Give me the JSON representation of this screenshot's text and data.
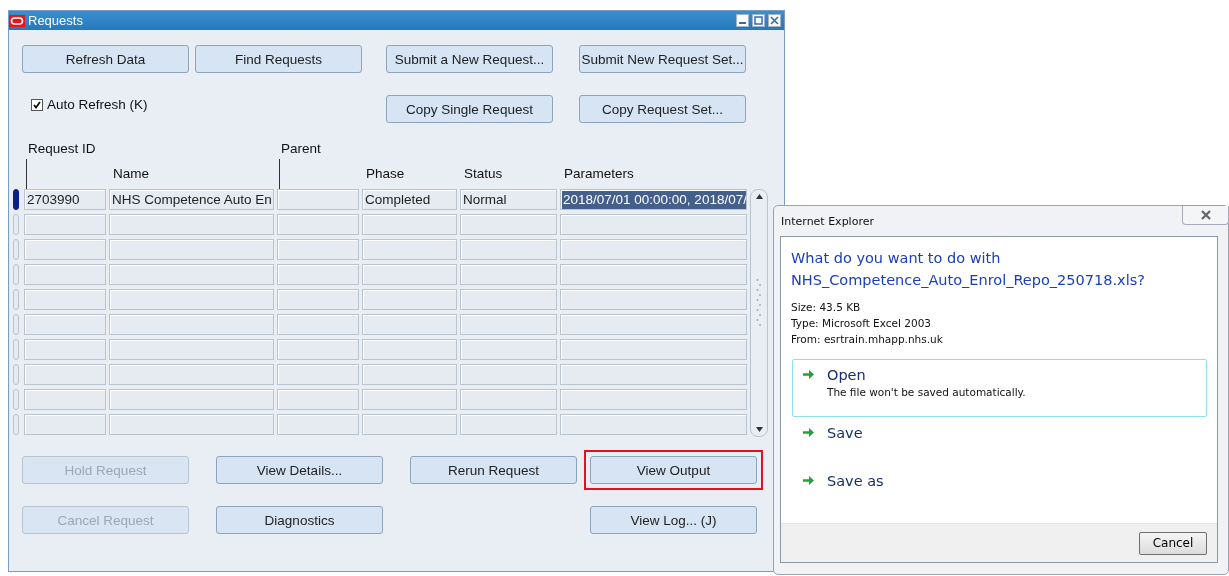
{
  "window": {
    "title": "Requests"
  },
  "button_rows": [
    [
      {
        "label": "Refresh Data",
        "disabled": false,
        "highlighted": false
      },
      {
        "label": "Find Requests",
        "disabled": false,
        "highlighted": false
      },
      {
        "label": "Submit a New Request...",
        "disabled": false,
        "highlighted": false
      },
      {
        "label": "Submit New Request Set...",
        "disabled": false,
        "highlighted": false
      }
    ],
    [
      {
        "label": "Copy Single Request",
        "disabled": false,
        "highlighted": false
      },
      {
        "label": "Copy Request Set...",
        "disabled": false,
        "highlighted": false
      }
    ]
  ],
  "auto_refresh": {
    "label": "Auto Refresh (K)",
    "checked": true
  },
  "table": {
    "columns": [
      {
        "label": "Request ID",
        "kind": "raised"
      },
      {
        "label": "Name",
        "kind": "plain"
      },
      {
        "label": "Parent",
        "kind": "raised"
      },
      {
        "label": "Phase",
        "kind": "plain"
      },
      {
        "label": "Status",
        "kind": "plain"
      },
      {
        "label": "Parameters",
        "kind": "plain"
      }
    ],
    "rows": [
      {
        "selected": true,
        "cells": [
          {
            "text": "2703990",
            "selected": false
          },
          {
            "text": "NHS Competence Auto En",
            "selected": false
          },
          {
            "text": "",
            "selected": false
          },
          {
            "text": "Completed",
            "selected": false
          },
          {
            "text": "Normal",
            "selected": false
          },
          {
            "text": "2018/07/01 00:00:00, 2018/07/",
            "selected": true
          }
        ]
      }
    ]
  },
  "action_rows": [
    [
      {
        "label": "Hold Request",
        "disabled": true,
        "highlighted": false
      },
      {
        "label": "View Details...",
        "disabled": false,
        "highlighted": false
      },
      {
        "label": "Rerun Request",
        "disabled": false,
        "highlighted": false
      },
      {
        "label": "View Output",
        "disabled": false,
        "highlighted": true
      }
    ],
    [
      {
        "label": "Cancel Request",
        "disabled": true,
        "highlighted": false
      },
      {
        "label": "Diagnostics",
        "disabled": false,
        "highlighted": false
      },
      {
        "label": "View Log... (J)",
        "disabled": false,
        "highlighted": false
      }
    ]
  ],
  "dialog": {
    "title": "Internet Explorer",
    "question_lines": [
      "What do you want to do with",
      "NHS_Competence_Auto_Enrol_Repo_250718.xls?"
    ],
    "details": [
      "Size: 43.5 KB",
      "Type: Microsoft Excel 2003",
      "From: esrtrain.mhapp.nhs.uk"
    ],
    "options": [
      {
        "label": "Open",
        "description": "The file won't be saved automatically.",
        "selected": true
      },
      {
        "label": "Save",
        "selected": false
      },
      {
        "label": "Save as",
        "selected": false
      }
    ],
    "cancel_button": "Cancel"
  }
}
